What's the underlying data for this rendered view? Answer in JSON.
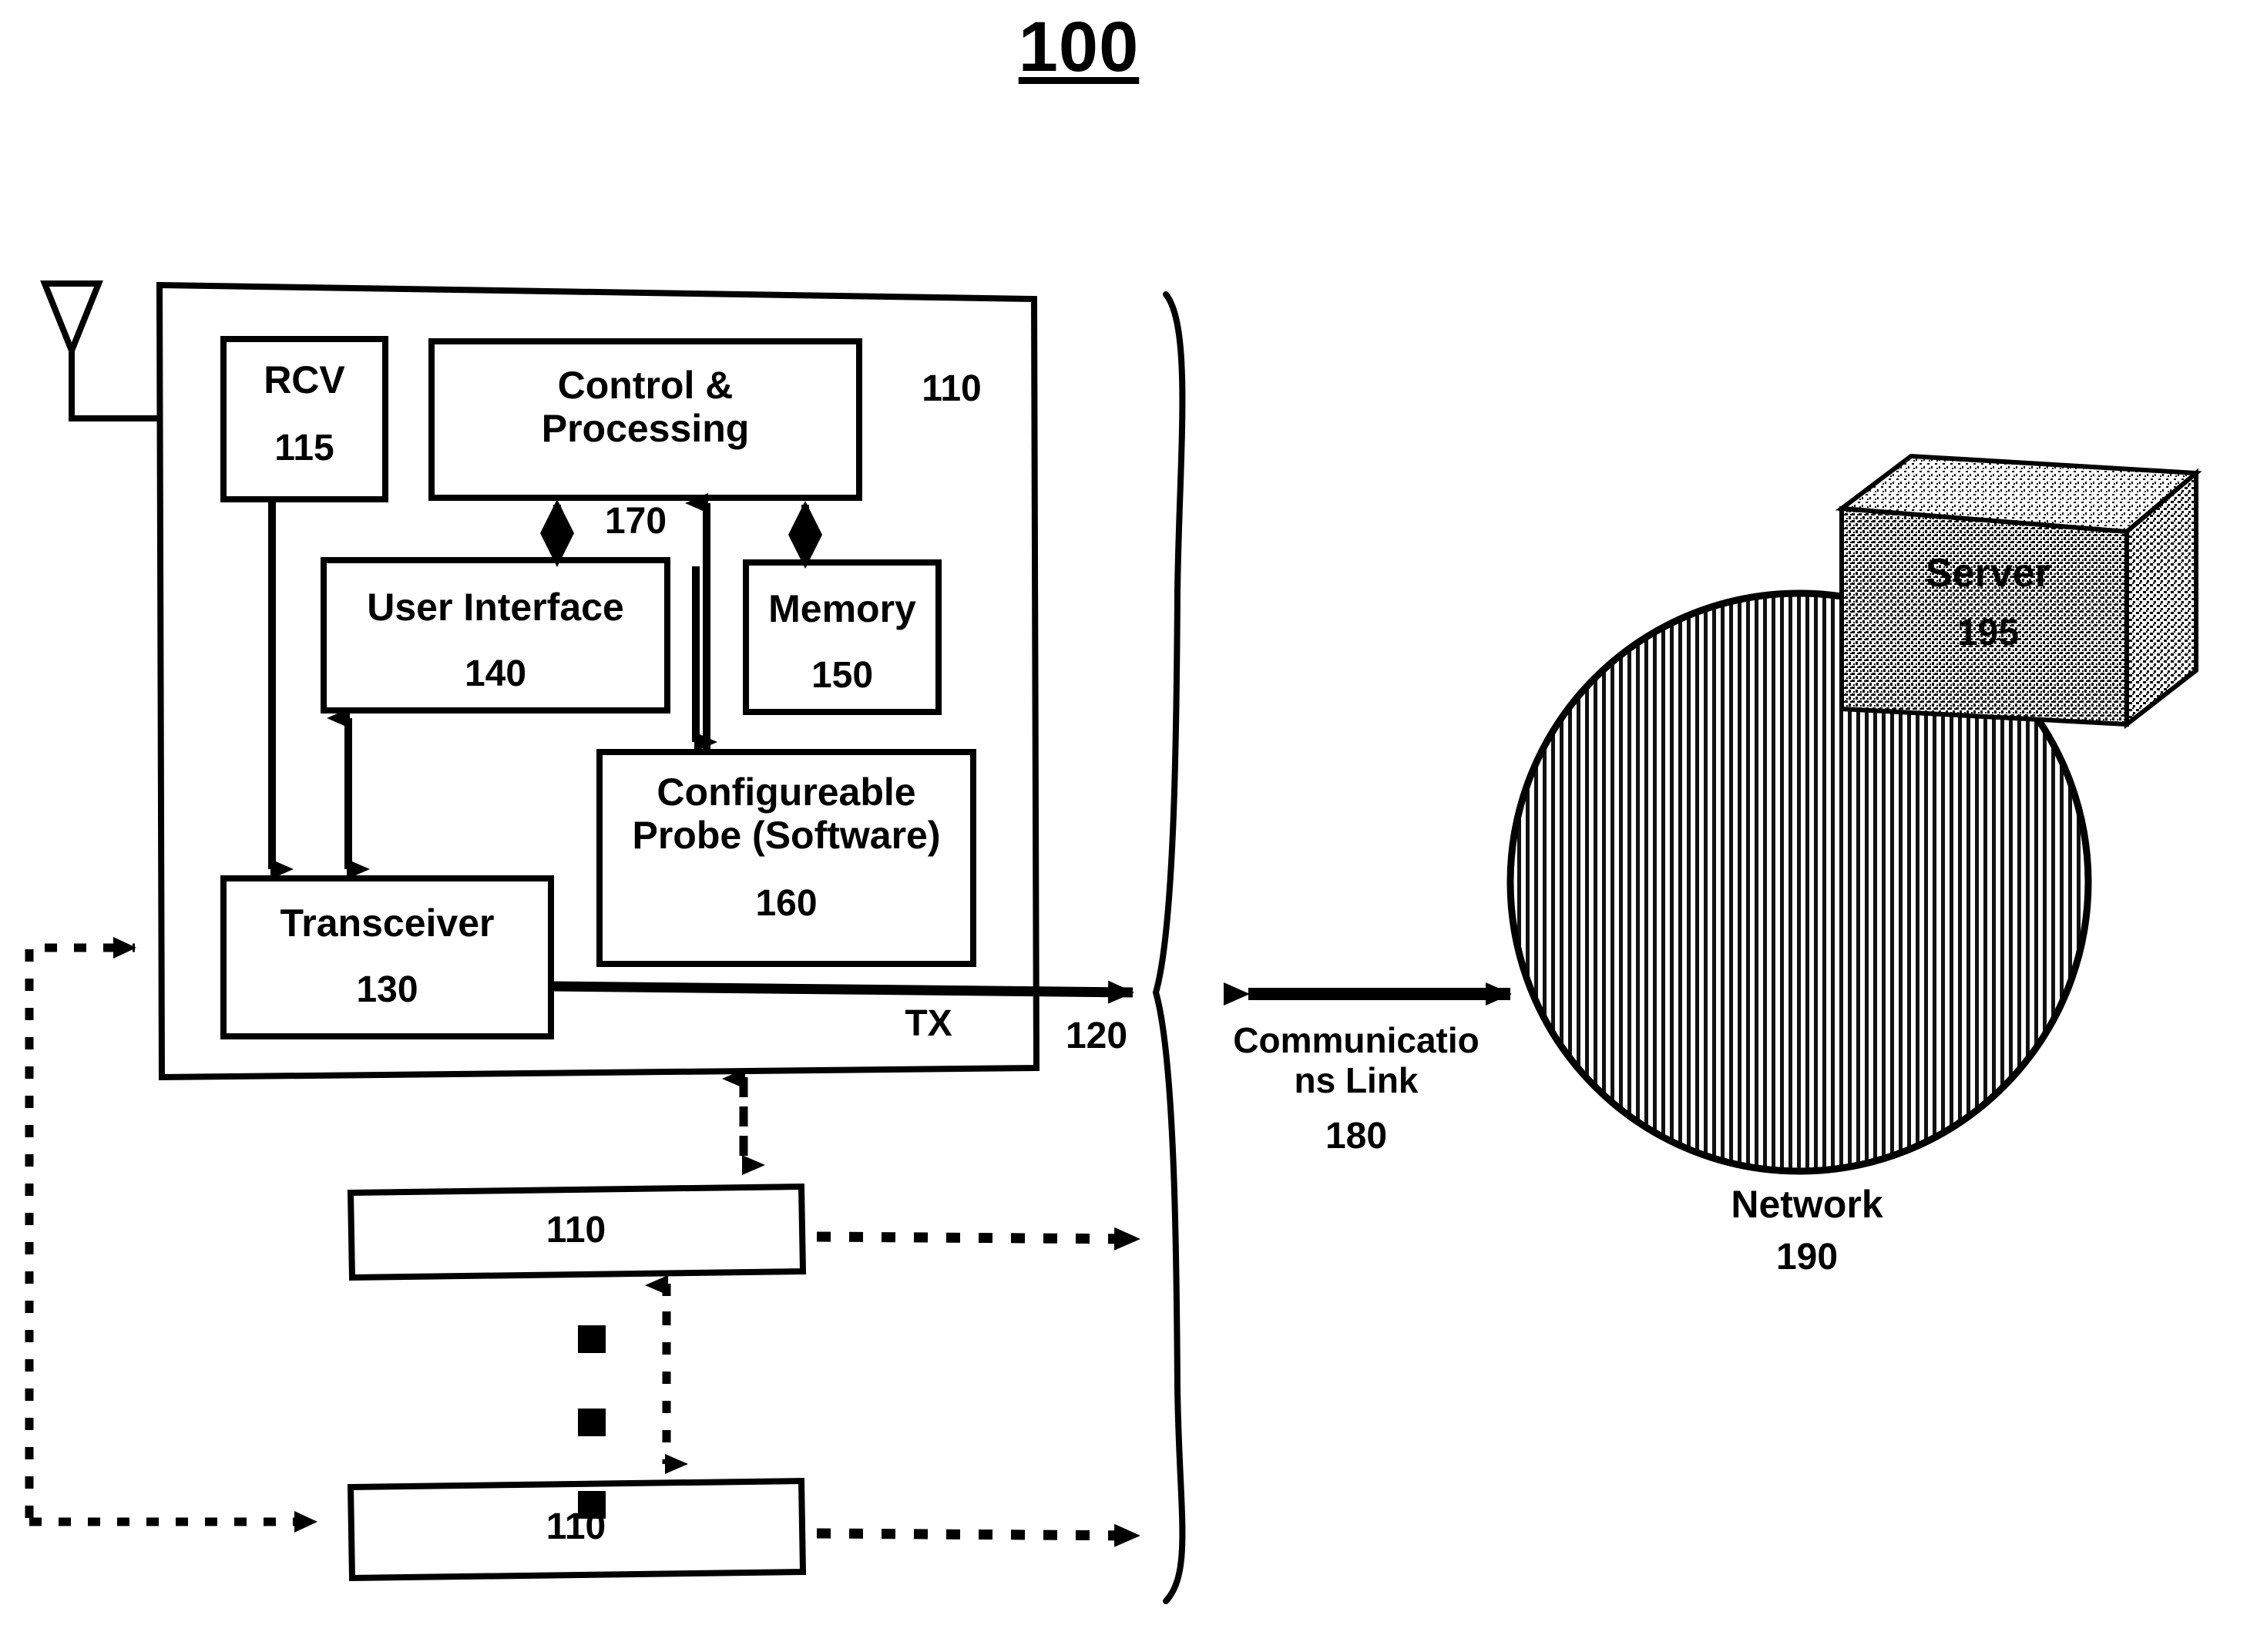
{
  "figure": {
    "title": "100",
    "type": "patent-block-diagram"
  },
  "device": {
    "outer_ref": "110",
    "tx_label": "TX",
    "tx_ref": "120",
    "bus_ref": "170",
    "antenna_icon": "antenna-icon",
    "blocks": [
      {
        "id": "rcv",
        "name": "RCV",
        "ref": "115"
      },
      {
        "id": "control",
        "name": "Control &\nProcessing",
        "ref": ""
      },
      {
        "id": "user_iface",
        "name": "User Interface",
        "ref": "140"
      },
      {
        "id": "memory",
        "name": "Memory",
        "ref": "150"
      },
      {
        "id": "probe",
        "name": "Configureable\nProbe (Software)",
        "ref": "160"
      },
      {
        "id": "xcvr",
        "name": "Transceiver",
        "ref": "130"
      }
    ]
  },
  "peer_devices": [
    {
      "id": "peer_top",
      "label": "110"
    },
    {
      "id": "peer_bottom",
      "label": "110"
    }
  ],
  "ellipsis": {
    "vertical_dots": "■ ■ ■"
  },
  "link": {
    "name": "Communicatio\nns Link",
    "ref": "180",
    "arrow": "double-headed-arrow-icon"
  },
  "network": {
    "name": "Network",
    "ref": "190",
    "shape": "hatched-circle"
  },
  "server": {
    "name": "Server",
    "ref": "195",
    "shape": "3d-box"
  },
  "colors": {
    "ink": "#000000",
    "paper": "#ffffff"
  }
}
